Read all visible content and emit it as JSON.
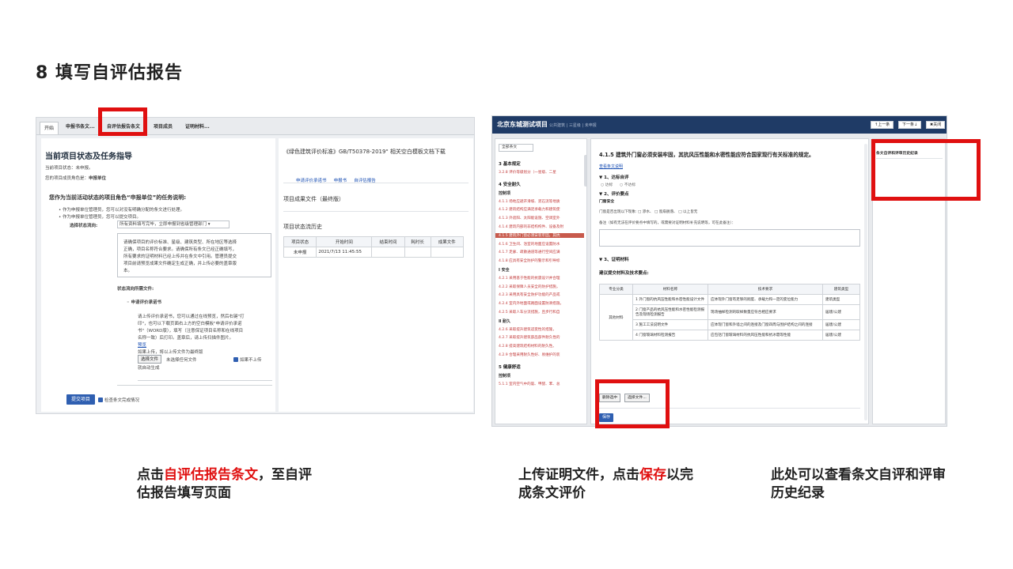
{
  "slide": {
    "title": "8 填写自评估报告"
  },
  "shotA": {
    "tabs": [
      "开始",
      "申报书条文...",
      "自评估报告条文",
      "项目成员",
      "证明材料..."
    ],
    "heading": "当前项目状态及任务指导",
    "status_line": "当前项目状态：未申报。",
    "role_label": "您的项目成员角色是：",
    "role_value": "申报单位",
    "task_heading": "您作为当前活动状态的项目角色“申报单位”的任务说明:",
    "bullets": [
      "作为申报单位管理员，您可以对没有明确分配的条文进行处理。",
      "作为申报单位管理员，您可以提交项目。"
    ],
    "direction_label": "选择状态流向:",
    "direction_value": "所有资料填写完毕，立即申报到省级管理部门",
    "instruction_lines": [
      "请确保项目的评价标准、星级、建筑类型、所在地区等选择",
      "正确，项目名称符合要求。请确保所有条文已经正确填写，",
      "所有要求的证明材料已经上传并在条文中引用。管理员提交",
      "项目前请预览成果文件确定生成正确，并上传必要的盖章版",
      "本。"
    ],
    "required_files_label": "状态流向所需文件:",
    "commitment_title": "申请评价承诺书",
    "upload_lines": [
      "请上传评价承诺书，您可以通过在线预览，然后右键\"打",
      "印\"，也可以下载页面右上方的空白模板\"申请评价承诺",
      "书\"（WORD版），填写（注意保证项目名称和在线项目",
      "名称一致）后打印。盖章后，请上传扫描件图片。"
    ],
    "preview_link": "预览",
    "existing_file_text": "如果上传，将以上传文件为最终版",
    "choose_file_btn": "选择文件",
    "no_file_text": "未选择任何文件",
    "no_upload_checkbox": "如果不上传",
    "auto_generate_text": "就自动生成",
    "submit_btn": "提交项目",
    "check_completion": "检查条文完成情况",
    "template_title": "《绿色建筑评价标准》GB/T50378-2019\" 相关空白模板文档下载",
    "template_links": [
      "申请评价承诺书",
      "申报书",
      "自评估报告"
    ],
    "result_files_heading": "项目成果文件（最终版）",
    "flow_history_heading": "项目状态流历史",
    "flow_table": {
      "headers": [
        "项目状态",
        "开始时间",
        "结束时间",
        "耗时长",
        "成果文件"
      ],
      "rows": [
        [
          "未申报",
          "2021/7/13 11:45:55",
          "",
          "",
          ""
        ]
      ]
    }
  },
  "shotB": {
    "app_title": "北京东城测试项目",
    "crumbs": "公共建筑 | 三星级 | 未申报",
    "prev_btn": "↑上一条",
    "next_btn": "下一条↓",
    "close_btn": "✖关闭",
    "nav": {
      "filter": "全部条文",
      "items": [
        {
          "t": "sec",
          "text": "3 基本规定"
        },
        {
          "t": "item",
          "text": "3.2.8 评价等级划分（一星级、二星"
        },
        {
          "t": "sec",
          "text": "4 安全耐久"
        },
        {
          "t": "sub",
          "text": "控制项"
        },
        {
          "t": "item",
          "text": "4.1.1 场地应避开滑坡、泥石流等地质"
        },
        {
          "t": "item",
          "text": "4.1.2 建筑结构应满足承载力和建筑使"
        },
        {
          "t": "item",
          "text": "4.1.3 外遮阳、太阳能设施、空调室外"
        },
        {
          "t": "item",
          "text": "4.1.4 建筑内部的非结构构件、设备及附"
        },
        {
          "t": "sel",
          "text": "4.1.5 建筑外门窗必须安装牢固，其抗"
        },
        {
          "t": "item",
          "text": "4.1.6 卫生间、浴室的地面应设置防水"
        },
        {
          "t": "item",
          "text": "4.1.7 走廊、疏散通道等通行空间应满"
        },
        {
          "t": "item",
          "text": "4.1.8 应具有安全防护的警示和引导标"
        },
        {
          "t": "sub",
          "text": "Ⅰ 安全"
        },
        {
          "t": "item",
          "text": "4.2.1 采用基于性能的抗震设计并合理"
        },
        {
          "t": "item",
          "text": "4.2.2 采取保障人员安全的防护措施，"
        },
        {
          "t": "item",
          "text": "4.2.3 采用具有安全防护功能的产品或"
        },
        {
          "t": "item",
          "text": "4.2.4 室内外地面或路面设置防滑措施。"
        },
        {
          "t": "item",
          "text": "4.2.5 采取人车分流措施，且步行和自"
        },
        {
          "t": "sub",
          "text": "Ⅱ 耐久"
        },
        {
          "t": "item",
          "text": "4.2.6 采取提升建筑适变性的措施，"
        },
        {
          "t": "item",
          "text": "4.2.7 采取提升建筑部品部件耐久性的"
        },
        {
          "t": "item",
          "text": "4.2.8 提高建筑结构材料的耐久性。"
        },
        {
          "t": "item",
          "text": "4.2.9 合理采用耐久性好、易维护的装"
        },
        {
          "t": "sec",
          "text": "5 健康舒适"
        },
        {
          "t": "sub",
          "text": "控制项"
        },
        {
          "t": "item",
          "text": "5.1.1 室内空气中的氨、甲醛、苯、总"
        }
      ]
    },
    "clause_title": "4.1.5 建筑外门窗必须安装牢固，其抗风压性能和水密性能应符合国家现行有关标准的规定。",
    "view_clause_link": "查看条文说明",
    "sec1": "▼ 1、达标自评",
    "radio_pass": "○ 达标",
    "radio_fail": "○ 不达标",
    "sec2": "▼ 2、评价要点",
    "door_safety": "门窗安全",
    "check_line": "门窗是否出现以下现象: □ 渗水、 □ 窗扇脱落、 □ 以上皆无",
    "remark_label": "备注（如有无法在评价要点中填写的，或需要对证明材料补充说明等，可在此备注）：",
    "sec3": "▼ 3、证明材料",
    "suggest_label": "建议提交材料及技术要点:",
    "mat_table": {
      "headers": [
        "专业分类",
        "材料名称",
        "技术要求",
        "建筑类型"
      ],
      "category": "其他材料",
      "rows": [
        [
          "1 外门窗的抗风压性能和水密性能设计文件",
          "应体现外门窗有足够的刚度、承载力和一定的变位能力",
          "建筑类型"
        ],
        [
          "2 门窗产品的抗风压性能和水密性能检测报告及现场检测报告",
          "现场抽样检测的取样数量应符合相应要求",
          "居建/公建"
        ],
        [
          "3 施工工法说明文件",
          "应体现门窗和外墙之间的连接及门窗四周与围护结构之间的连接",
          "居建/公建"
        ],
        [
          "4 门窗玻璃材料检测报告",
          "应包括门窗玻璃材料的抗风压性能和抗冰雹等性能",
          "居建/公建"
        ]
      ]
    },
    "delete_btn": "删除选中",
    "choose_files_btn": "选择文件...",
    "save_btn": "保存",
    "history_title": "条文自评和评审历史纪录"
  },
  "captions": {
    "cap1_pre": "点击",
    "cap1_red": "自评估报告条文",
    "cap1_post": "，至自评",
    "cap1_line2": "估报告填写页面",
    "cap2_pre": "上传证明文件，点击",
    "cap2_red": "保存",
    "cap2_post": "以完",
    "cap2_line2": "成条文评价",
    "cap3_line1": "此处可以查看条文自评和评审",
    "cap3_line2": "历史纪录"
  },
  "colors": {
    "highlight": "#e01010",
    "topbar": "#1f3b66",
    "accent_blue": "#2f5fb1"
  }
}
